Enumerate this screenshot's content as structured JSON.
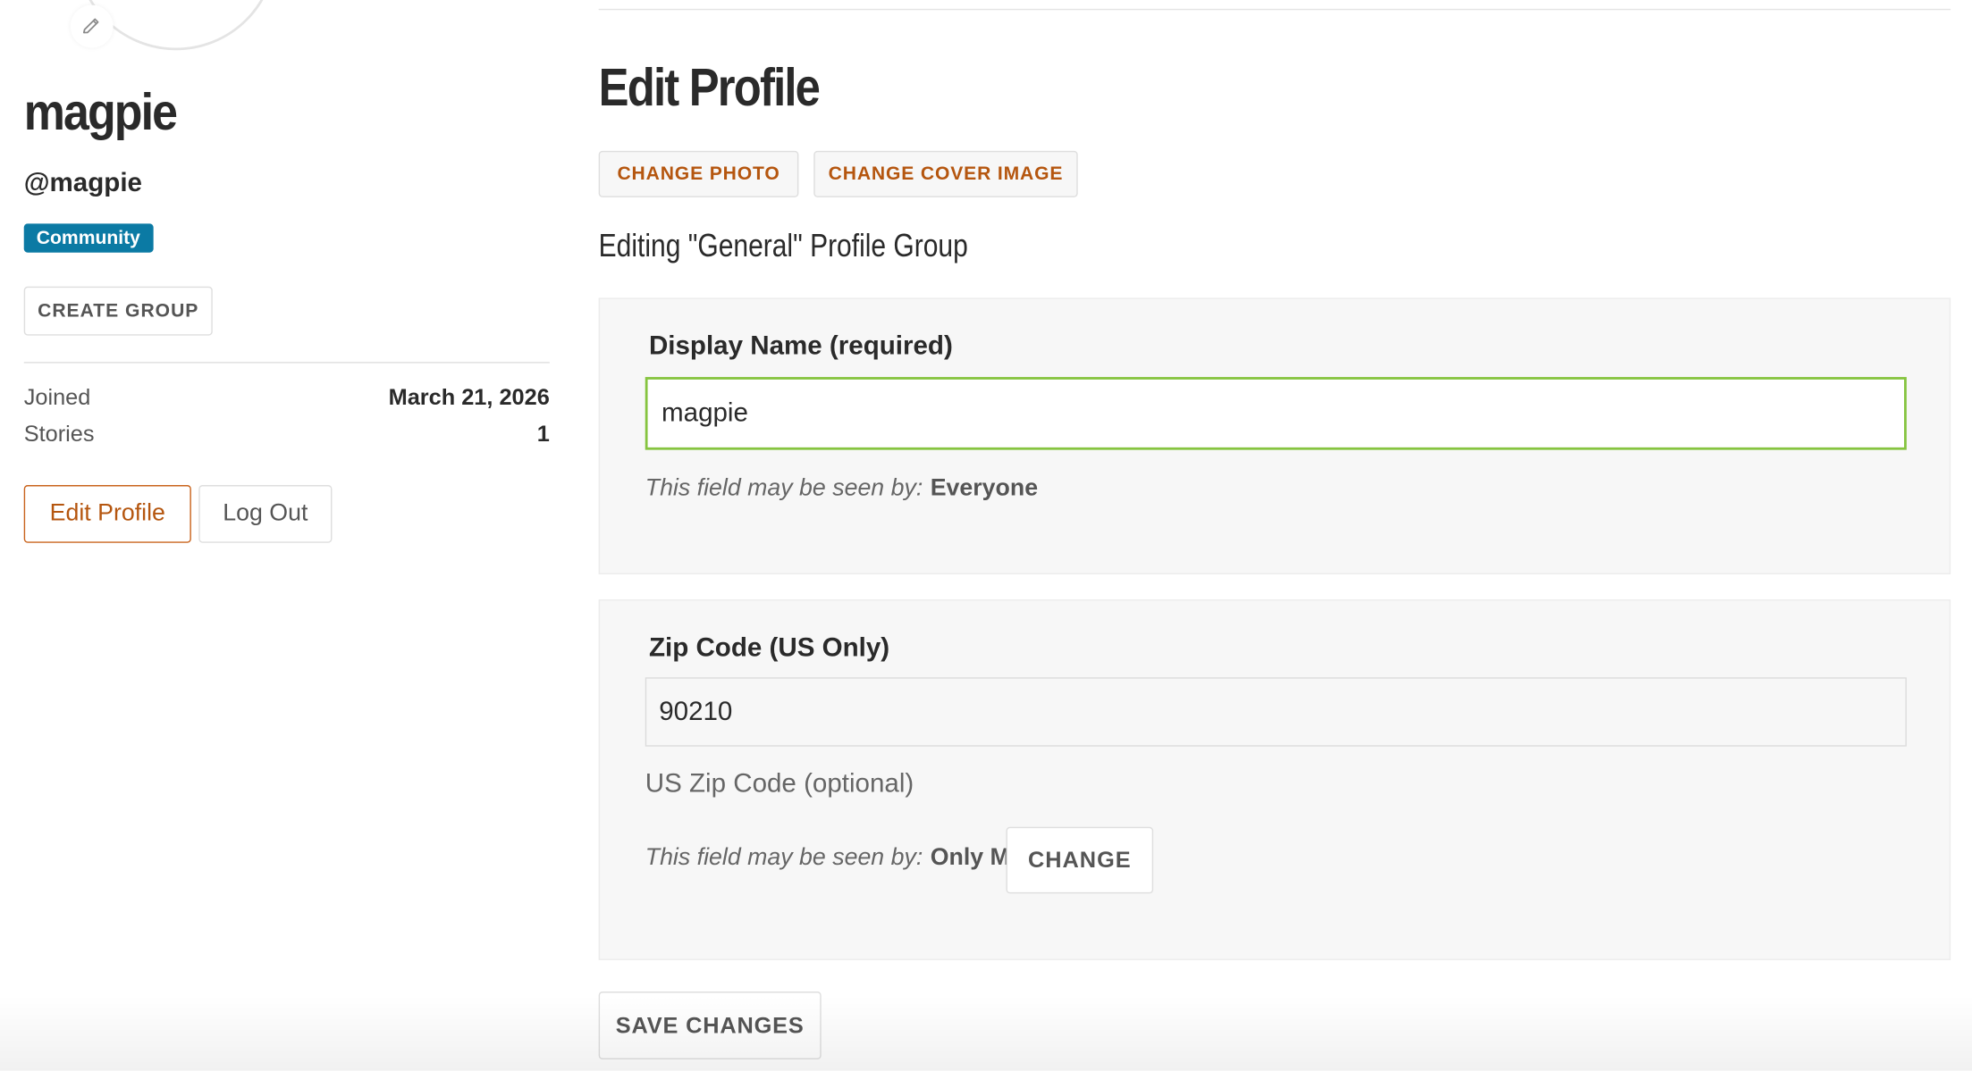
{
  "profile": {
    "display_name": "magpie",
    "handle": "@magpie",
    "member_type": "Community",
    "create_group_label": "CREATE GROUP",
    "stats": [
      {
        "label": "Joined",
        "value": "March 21, 2026"
      },
      {
        "label": "Stories",
        "value": "1"
      }
    ],
    "edit_profile_label": "Edit Profile",
    "log_out_label": "Log Out"
  },
  "main": {
    "title": "Edit Profile",
    "change_photo_label": "CHANGE PHOTO",
    "change_cover_label": "CHANGE COVER IMAGE",
    "group_heading": "Editing \"General\" Profile Group",
    "fields": [
      {
        "label": "Display Name (required)",
        "value": "magpie",
        "visibility_prefix": "This field may be seen by:",
        "visibility_level": "Everyone"
      },
      {
        "label": "Zip Code (US Only)",
        "value": "90210",
        "help": "US Zip Code (optional)",
        "visibility_prefix": "This field may be seen by:",
        "visibility_level": "Only Me",
        "change_label": "CHANGE"
      }
    ],
    "save_label": "SAVE CHANGES"
  },
  "colors": {
    "accent": "#b5560f",
    "badge": "#0b7aa4",
    "focus_border": "#86c440"
  },
  "icons": {
    "avatar_edit": "pencil-icon"
  }
}
